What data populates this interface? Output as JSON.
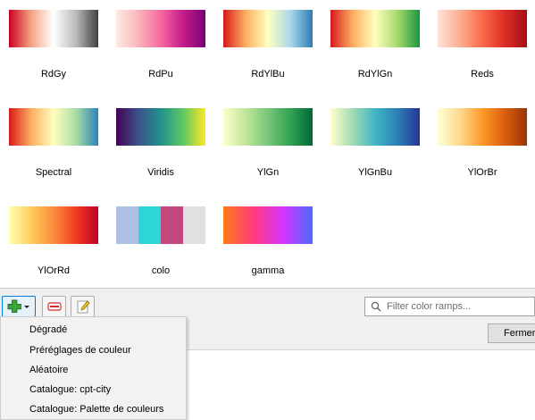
{
  "ramps": [
    {
      "label": "RdGy",
      "colors": [
        "#ca0020",
        "#f4a582",
        "#ffffff",
        "#bababa",
        "#404040"
      ]
    },
    {
      "label": "RdPu",
      "colors": [
        "#feebe2",
        "#fbb4b9",
        "#f768a1",
        "#c51b8a",
        "#7a0177"
      ]
    },
    {
      "label": "RdYlBu",
      "colors": [
        "#d7191c",
        "#fdae61",
        "#ffffbf",
        "#abd9e9",
        "#2c7bb6"
      ]
    },
    {
      "label": "RdYlGn",
      "colors": [
        "#d7191c",
        "#fdae61",
        "#ffffbf",
        "#a6d96a",
        "#1a9641"
      ]
    },
    {
      "label": "Reds",
      "colors": [
        "#fee5d9",
        "#fcae91",
        "#fb6a4a",
        "#de2d26",
        "#a50f15"
      ]
    },
    {
      "label": "Spectral",
      "colors": [
        "#d7191c",
        "#fdae61",
        "#ffffbf",
        "#abdda4",
        "#2b83ba"
      ]
    },
    {
      "label": "Viridis",
      "colors": [
        "#440154",
        "#3b528b",
        "#21918c",
        "#5ec962",
        "#fde725"
      ]
    },
    {
      "label": "YlGn",
      "colors": [
        "#ffffcc",
        "#c2e699",
        "#78c679",
        "#31a354",
        "#006837"
      ]
    },
    {
      "label": "YlGnBu",
      "colors": [
        "#ffffcc",
        "#a1dab4",
        "#41b6c4",
        "#2c7fb8",
        "#253494"
      ]
    },
    {
      "label": "YlOrBr",
      "colors": [
        "#ffffd4",
        "#fed98e",
        "#fe9929",
        "#d95f0e",
        "#993404"
      ]
    },
    {
      "label": "YlOrRd",
      "colors": [
        "#ffffb2",
        "#fecc5c",
        "#fd8d3c",
        "#f03b20",
        "#bd0026"
      ]
    },
    {
      "label": "colo",
      "colors": [
        "#aec0e4",
        "#2ad6d6",
        "#c4467e",
        "#e0e0e0"
      ],
      "discrete": true
    },
    {
      "label": "gamma",
      "colors": [
        "#ff7b16",
        "#ff3c7c",
        "#d633ff",
        "#4d6cff"
      ]
    }
  ],
  "toolbar": {
    "search_placeholder": "Filter color ramps...",
    "close_label": "Fermer"
  },
  "menu": {
    "items": [
      "Dégradé",
      "Préréglages de couleur",
      "Aléatoire",
      "Catalogue: cpt-city",
      "Catalogue: Palette de couleurs"
    ]
  }
}
